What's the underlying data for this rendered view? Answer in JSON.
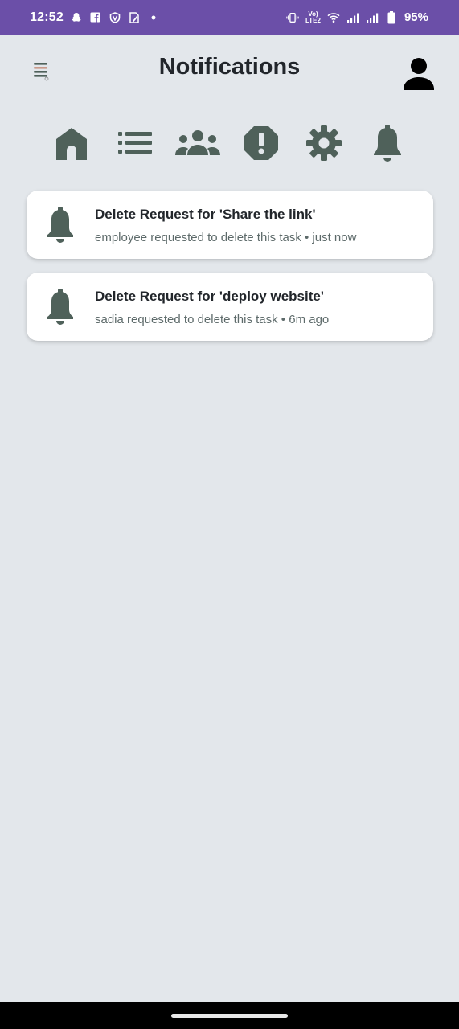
{
  "status_bar": {
    "time": "12:52",
    "lte_line1": "Vo)",
    "lte_line2": "LTE2",
    "battery": "95%",
    "icons": [
      "snapchat-icon",
      "facebook-icon",
      "vpn-icon",
      "sim-edit-icon",
      "dot-icon",
      "vibrate-icon",
      "volte-icon",
      "wifi-icon",
      "signal-icon",
      "signal-icon",
      "battery-icon"
    ]
  },
  "header": {
    "title": "Notifications",
    "menu_icon": "hamburger-menu-icon",
    "profile_icon": "user-icon"
  },
  "nav": {
    "items": [
      {
        "icon": "home-icon"
      },
      {
        "icon": "list-icon"
      },
      {
        "icon": "users-icon"
      },
      {
        "icon": "alert-octagon-icon"
      },
      {
        "icon": "gear-icon"
      },
      {
        "icon": "bell-icon"
      }
    ],
    "icon_color": "#4f615a"
  },
  "notifications": [
    {
      "title": "Delete Request for 'Share the link'",
      "subtitle": "employee requested to delete this task • just now",
      "icon": "bell-icon"
    },
    {
      "title": "Delete Request for 'deploy website'",
      "subtitle": "sadia requested to delete this task • 6m ago",
      "icon": "bell-icon"
    }
  ],
  "colors": {
    "status_bar": "#6b4fa8",
    "background": "#e3e7eb",
    "icon": "#4f615a",
    "title": "#22262b"
  }
}
